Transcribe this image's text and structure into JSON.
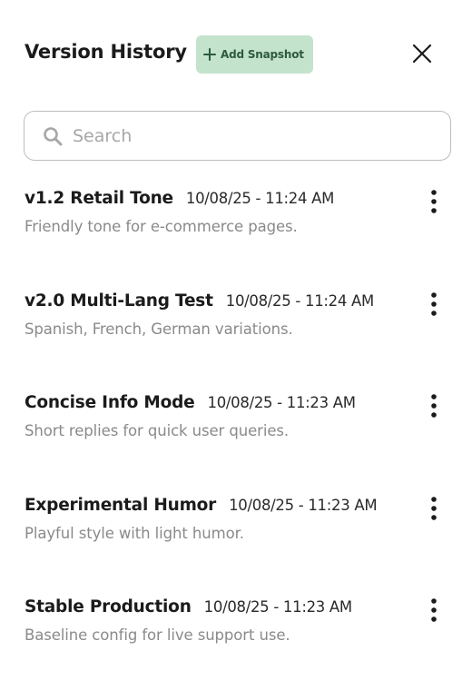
{
  "header": {
    "title": "Version History",
    "add_snapshot_label": "Add Snapshot"
  },
  "search": {
    "placeholder": "Search",
    "value": ""
  },
  "icons": {
    "add": "plus-icon",
    "close": "close-icon",
    "search": "search-icon",
    "menu": "more-vertical-icon"
  },
  "colors": {
    "accent_bg": "#c3e3cd",
    "accent_text": "#2d5a3e",
    "description_text": "#8a8a8a"
  },
  "versions": [
    {
      "name": "v1.2 Retail Tone",
      "timestamp": "10/08/25 - 11:24 AM",
      "description": "Friendly tone for e-commerce pages."
    },
    {
      "name": "v2.0 Multi-Lang Test",
      "timestamp": "10/08/25 - 11:24 AM",
      "description": "Spanish, French, German variations."
    },
    {
      "name": "Concise Info Mode",
      "timestamp": "10/08/25 - 11:23 AM",
      "description": "Short replies for quick user queries."
    },
    {
      "name": "Experimental Humor",
      "timestamp": "10/08/25 - 11:23 AM",
      "description": "Playful style with light humor."
    },
    {
      "name": "Stable Production",
      "timestamp": "10/08/25 - 11:23 AM",
      "description": "Baseline config for live support use."
    }
  ]
}
